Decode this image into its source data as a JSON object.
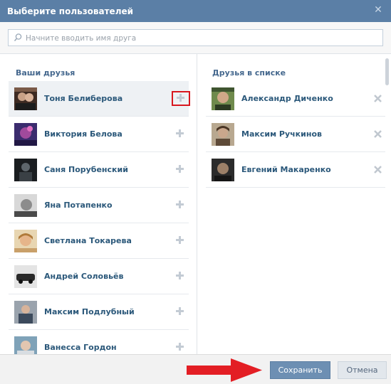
{
  "dialog": {
    "title": "Выберите пользователей"
  },
  "search": {
    "placeholder": "Начните вводить имя друга",
    "value": ""
  },
  "left": {
    "title": "Ваши друзья",
    "friends": [
      {
        "name": "Тоня Белиберова"
      },
      {
        "name": "Виктория Белова"
      },
      {
        "name": "Саня Порубенский"
      },
      {
        "name": "Яна Потапенко"
      },
      {
        "name": "Светлана Токарева"
      },
      {
        "name": "Андрей Соловьёв"
      },
      {
        "name": "Максим Подлубный"
      },
      {
        "name": "Ванесса Гордон"
      }
    ]
  },
  "right": {
    "title": "Друзья в списке",
    "selected": [
      {
        "name": "Александр Диченко"
      },
      {
        "name": "Максим Ручкинов"
      },
      {
        "name": "Евгений Макаренко"
      }
    ]
  },
  "footer": {
    "save_label": "Сохранить",
    "cancel_label": "Отмена"
  },
  "colors": {
    "titlebar": "#5b7fa6",
    "link": "#2b587a",
    "section": "#45688e",
    "highlight": "#d8171f",
    "save_button": "#6d8fb3"
  }
}
